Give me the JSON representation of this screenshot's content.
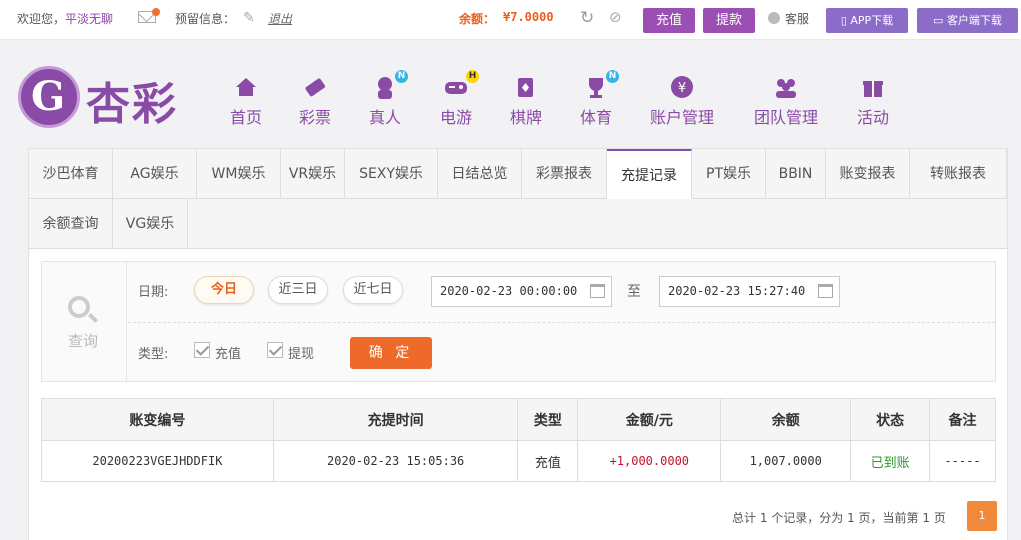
{
  "topbar": {
    "welcome": "欢迎您，",
    "username": "平淡无聊",
    "warning_label": "预留信息：",
    "logout": "退出",
    "balance_label": "余额：",
    "balance_value": "¥7.0000",
    "deposit_button": "充值",
    "withdraw_button": "提款",
    "service_label": "客服",
    "app_download": "APP下载",
    "client_download": "客户端下载"
  },
  "logo": {
    "text": "杏彩",
    "emblem_letter": "G"
  },
  "nav": [
    {
      "label": "首页",
      "icon": "home-icon"
    },
    {
      "label": "彩票",
      "icon": "ticket-icon"
    },
    {
      "label": "真人",
      "icon": "dealer-icon",
      "badge": "N"
    },
    {
      "label": "电游",
      "icon": "gamepad-icon",
      "badge": "H"
    },
    {
      "label": "棋牌",
      "icon": "cards-icon"
    },
    {
      "label": "体育",
      "icon": "trophy-icon",
      "badge": "N"
    },
    {
      "label": "账户管理",
      "icon": "yen-icon"
    },
    {
      "label": "团队管理",
      "icon": "team-icon"
    },
    {
      "label": "活动",
      "icon": "gift-icon"
    }
  ],
  "tabs": [
    "沙巴体育",
    "AG娱乐",
    "WM娱乐",
    "VR娱乐",
    "SEXY娱乐",
    "日结总览",
    "彩票报表",
    "充提记录",
    "PT娱乐",
    "BBIN",
    "账变报表",
    "转账报表",
    "余额查询",
    "VG娱乐"
  ],
  "active_tab": "充提记录",
  "filter": {
    "query_label": "查询",
    "date_label": "日期:",
    "date_buttons": [
      "今日",
      "近三日",
      "近七日"
    ],
    "start_datetime": "2020-02-23 00:00:00",
    "to_label": "至",
    "end_datetime": "2020-02-23 15:27:40",
    "type_label": "类型:",
    "type_options": [
      "充值",
      "提现"
    ],
    "confirm_button": "确 定"
  },
  "table": {
    "headers": [
      "账变编号",
      "充提时间",
      "类型",
      "金额/元",
      "余额",
      "状态",
      "备注"
    ],
    "rows": [
      [
        "20200223VGEJHDDFIK",
        "2020-02-23 15:05:36",
        "充值",
        "+1,000.0000",
        "1,007.0000",
        "已到账",
        "-----"
      ]
    ]
  },
  "pager": {
    "summary": "总计 1 个记录，分为 1 页，当前第 1 页",
    "current_page": "1"
  }
}
